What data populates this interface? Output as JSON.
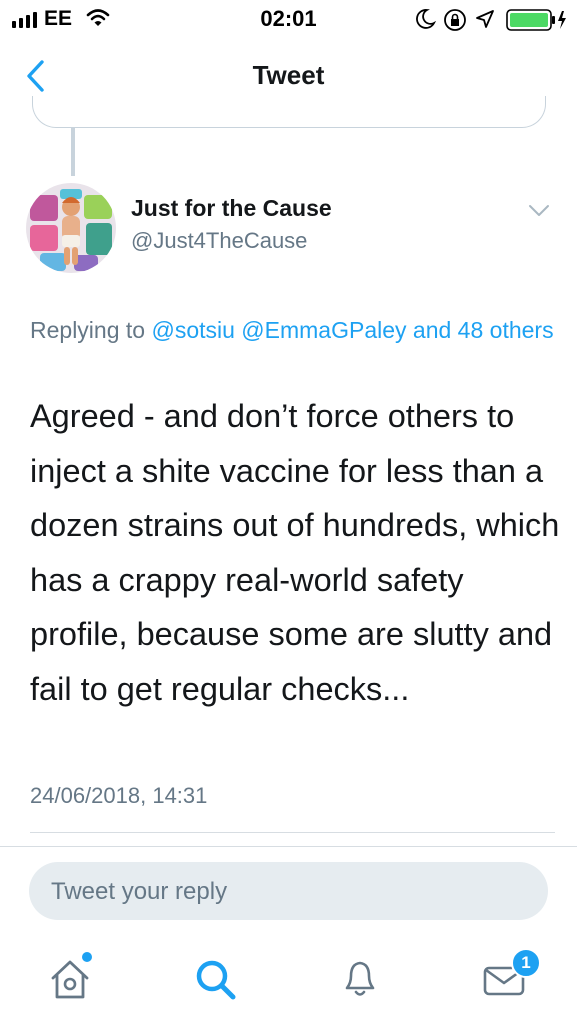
{
  "status_bar": {
    "carrier": "EE",
    "time": "02:01",
    "battery_color": "#4cd964"
  },
  "nav": {
    "back_icon": "chevron-left-icon",
    "title": "Tweet"
  },
  "tweet": {
    "author_name": "Just for the Cause",
    "author_handle": "@Just4TheCause",
    "reply_prefix": "Replying to",
    "reply_mention_1": "@sotsiu",
    "reply_mention_2": "@EmmaGPaley",
    "reply_others": "and 48 others",
    "text": "Agreed - and don’t force others to inject a shite vaccine for less than a dozen strains out of hundreds, which has a crappy real-world safety profile, because some are slutty and fail to get regular checks...",
    "timestamp": "24/06/2018, 14:31"
  },
  "reply_box": {
    "placeholder": "Tweet your reply"
  },
  "tab_bar": {
    "items": [
      "home-icon",
      "search-icon",
      "notifications-icon",
      "messages-icon"
    ],
    "messages_badge": "1",
    "accent": "#1da1f2"
  }
}
